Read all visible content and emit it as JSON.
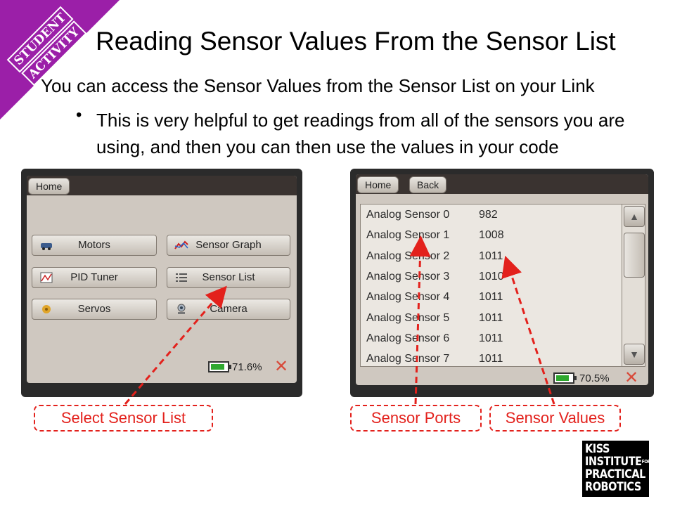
{
  "banner": {
    "line1": "STUDENT",
    "line2": "ACTIVITY",
    "color": "#9b1fa8"
  },
  "title": "Reading Sensor Values From the Sensor List",
  "subtitle": "You can access the Sensor Values from the Sensor List on your Link",
  "bullet": "This is very helpful to get readings from all of the sensors you are using, and then you can then use the values in your code",
  "left_screen": {
    "home_label": "Home",
    "buttons": [
      {
        "label": "Motors",
        "icon": "car-icon"
      },
      {
        "label": "Sensor Graph",
        "icon": "graph-icon"
      },
      {
        "label": "PID Tuner",
        "icon": "pid-chart-icon"
      },
      {
        "label": "Sensor List",
        "icon": "list-icon"
      },
      {
        "label": "Servos",
        "icon": "servo-icon"
      },
      {
        "label": "Camera",
        "icon": "camera-icon"
      }
    ],
    "battery": "71.6%",
    "battery_level": 0.716
  },
  "right_screen": {
    "home_label": "Home",
    "back_label": "Back",
    "sensors": [
      {
        "name": "Analog Sensor 0",
        "value": "982"
      },
      {
        "name": "Analog Sensor 1",
        "value": "1008"
      },
      {
        "name": "Analog Sensor 2",
        "value": "1011"
      },
      {
        "name": "Analog Sensor 3",
        "value": "1010"
      },
      {
        "name": "Analog Sensor 4",
        "value": "1011"
      },
      {
        "name": "Analog Sensor 5",
        "value": "1011"
      },
      {
        "name": "Analog Sensor 6",
        "value": "1011"
      },
      {
        "name": "Analog Sensor 7",
        "value": "1011"
      }
    ],
    "battery": "70.5%",
    "battery_level": 0.705
  },
  "callouts": {
    "select": "Select Sensor List",
    "ports": "Sensor Ports",
    "values": "Sensor Values",
    "color": "#e3211c"
  },
  "logo": {
    "line1": "KISS",
    "line2": "INSTITUTE",
    "line2_suffix": "FOR",
    "line3": "PRACTICAL",
    "line4": "ROBOTICS"
  }
}
